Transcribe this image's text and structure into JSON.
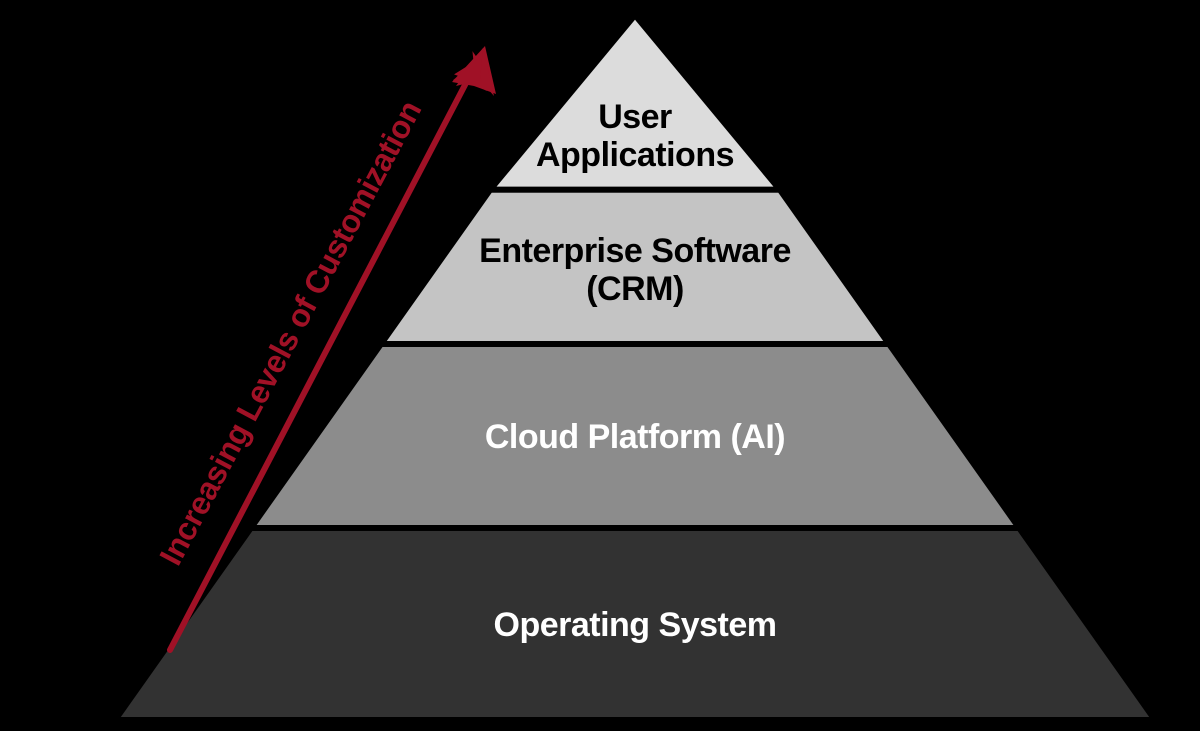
{
  "diagram": {
    "arrow_label": "Increasing Levels of Customization",
    "levels": [
      {
        "label_line1": "User",
        "label_line2": "Applications",
        "fill": "#dcdcdc",
        "text_fill": "#000000"
      },
      {
        "label_line1": "Enterprise Software",
        "label_line2": "(CRM)",
        "fill": "#c4c4c4",
        "text_fill": "#000000"
      },
      {
        "label_line1": "Cloud Platform (AI)",
        "label_line2": "",
        "fill": "#8c8c8c",
        "text_fill": "#ffffff"
      },
      {
        "label_line1": "Operating System",
        "label_line2": "",
        "fill": "#323232",
        "text_fill": "#ffffff"
      }
    ]
  },
  "chart_data": {
    "type": "pyramid",
    "title": "",
    "axis_label": "Increasing Levels of Customization",
    "axis_direction": "bottom-to-top",
    "levels_top_to_bottom": [
      "User Applications",
      "Enterprise Software (CRM)",
      "Cloud Platform (AI)",
      "Operating System"
    ]
  }
}
